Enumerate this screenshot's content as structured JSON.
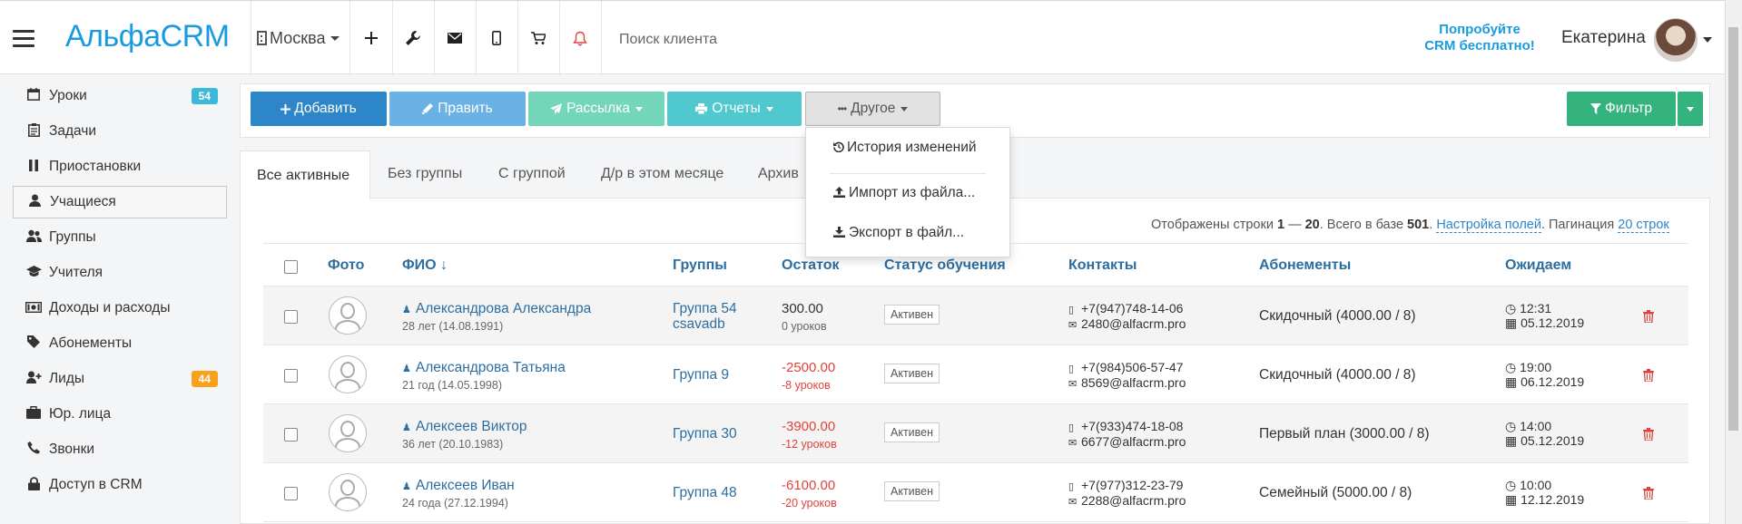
{
  "header": {
    "logo": "АльфаCRM",
    "city": "Москва",
    "search_placeholder": "Поиск клиента",
    "promo_line1": "Попробуйте",
    "promo_line2": "CRM бесплатно!",
    "user_name": "Екатерина"
  },
  "sidebar": {
    "items": [
      {
        "label": "Уроки",
        "icon": "calendar-icon",
        "badge": "54"
      },
      {
        "label": "Задачи",
        "icon": "clipboard-icon"
      },
      {
        "label": "Приостановки",
        "icon": "pause-icon"
      },
      {
        "label": "Учащиеся",
        "icon": "user-icon"
      },
      {
        "label": "Группы",
        "icon": "users-icon"
      },
      {
        "label": "Учителя",
        "icon": "graduation-cap-icon"
      },
      {
        "label": "Доходы и расходы",
        "icon": "money-icon"
      },
      {
        "label": "Абонементы",
        "icon": "tag-icon"
      },
      {
        "label": "Лиды",
        "icon": "user-plus-icon",
        "badge": "44"
      },
      {
        "label": "Юр. лица",
        "icon": "briefcase-icon"
      },
      {
        "label": "Звонки",
        "icon": "phone-icon"
      },
      {
        "label": "Доступ в CRM",
        "icon": "lock-icon"
      }
    ]
  },
  "toolbar": {
    "add": "Добавить",
    "edit": "Править",
    "mailing": "Рассылка",
    "reports": "Отчеты",
    "other": "Другое",
    "filter": "Фильтр"
  },
  "dropdown": {
    "history": "История изменений",
    "import": "Импорт из файла...",
    "export": "Экспорт в файл..."
  },
  "tabs": [
    "Все активные",
    "Без группы",
    "С группой",
    "Д/р в этом месяце",
    "Архив"
  ],
  "info": {
    "shown": "Отображены строки ",
    "range_from": "1",
    "dash": " — ",
    "range_to": "20",
    "total_text": ". Всего в базе ",
    "total": "501",
    "dot": ". ",
    "fields_link": "Настройка полей",
    "pagination_text": ". Пагинация ",
    "pagination_link": "20 строк"
  },
  "table": {
    "columns": {
      "photo": "Фото",
      "fio": "ФИО ↓",
      "groups": "Группы",
      "balance": "Остаток",
      "status": "Статус обучения",
      "contacts": "Контакты",
      "subscriptions": "Абонементы",
      "expected": "Ожидаем"
    },
    "rows": [
      {
        "name": "Александрова Александра",
        "age": "28 лет (14.08.1991)",
        "group": "Группа 54",
        "group2": "csavadb",
        "balance": "300.00",
        "lessons": "0 уроков",
        "status": "Активен",
        "phone": "+7(947)748-14-06",
        "email": "2480@alfacrm.pro",
        "subscription": "Скидочный (4000.00 / 8)",
        "time": "12:31",
        "date": "05.12.2019"
      },
      {
        "name": "Александрова Татьяна",
        "age": "21 год (14.05.1998)",
        "group": "Группа 9",
        "group2": "",
        "balance": "-2500.00",
        "lessons": "-8 уроков",
        "status": "Активен",
        "phone": "+7(984)506-57-47",
        "email": "8569@alfacrm.pro",
        "subscription": "Скидочный (4000.00 / 8)",
        "time": "19:00",
        "date": "06.12.2019"
      },
      {
        "name": "Алексеев Виктор",
        "age": "36 лет (20.10.1983)",
        "group": "Группа 30",
        "group2": "",
        "balance": "-3900.00",
        "lessons": "-12 уроков",
        "status": "Активен",
        "phone": "+7(933)474-18-08",
        "email": "6677@alfacrm.pro",
        "subscription": "Первый план (3000.00 / 8)",
        "time": "14:00",
        "date": "05.12.2019"
      },
      {
        "name": "Алексеев Иван",
        "age": "24 года (27.12.1994)",
        "group": "Группа 48",
        "group2": "",
        "balance": "-6100.00",
        "lessons": "-20 уроков",
        "status": "Активен",
        "phone": "+7(977)312-23-79",
        "email": "2288@alfacrm.pro",
        "subscription": "Семейный (5000.00 / 8)",
        "time": "10:00",
        "date": "12.12.2019"
      }
    ]
  },
  "colors": {
    "brand": "#1a9be0",
    "link": "#2d6ea0",
    "negative": "#e0433e",
    "badge_blue": "#3cb8d8",
    "badge_orange": "#f7a21a"
  }
}
